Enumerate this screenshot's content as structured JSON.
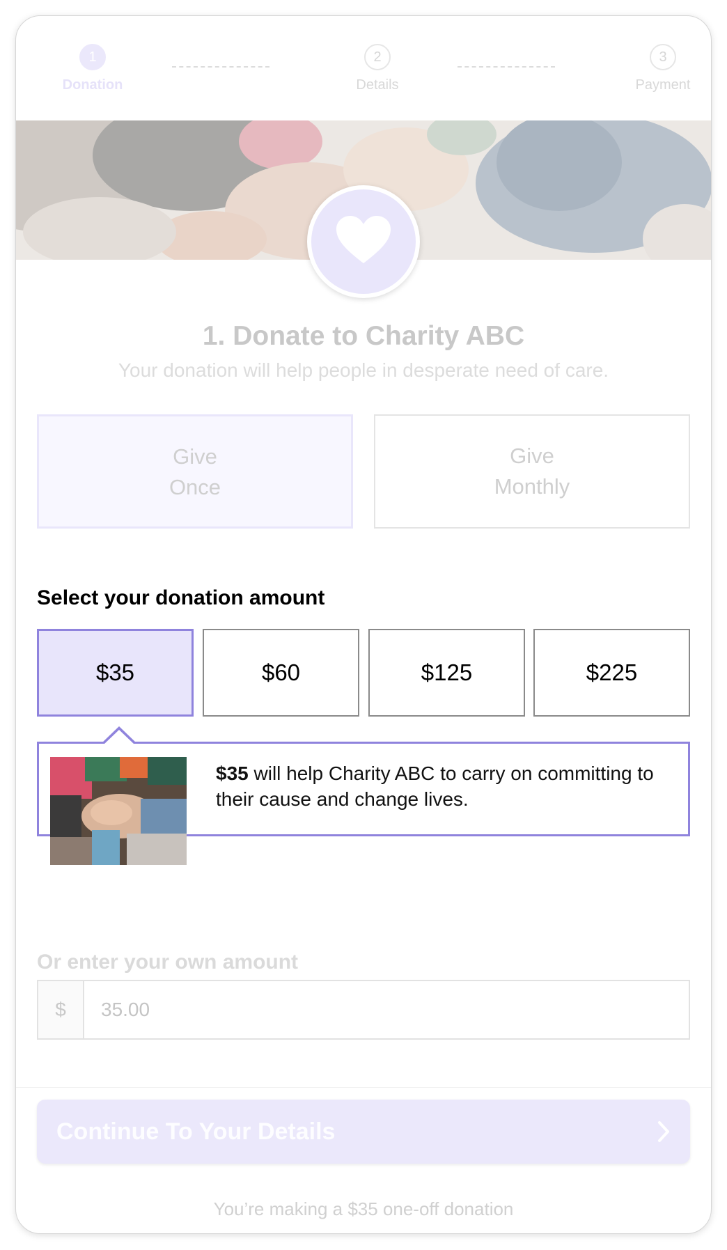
{
  "stepper": {
    "steps": [
      {
        "num": "1",
        "label": "Donation"
      },
      {
        "num": "2",
        "label": "Details"
      },
      {
        "num": "3",
        "label": "Payment"
      }
    ]
  },
  "header": {
    "title": "1. Donate to Charity ABC",
    "subtitle": "Your donation will help people in desperate need of care."
  },
  "frequency": {
    "once_line1": "Give",
    "once_line2": "Once",
    "monthly_line1": "Give",
    "monthly_line2": "Monthly",
    "selected": "once"
  },
  "amount": {
    "heading": "Select your donation amount",
    "options": [
      "$35",
      "$60",
      "$125",
      "$225"
    ],
    "selected": "$35"
  },
  "impact": {
    "amount": "$35",
    "text": " will help Charity ABC to carry on committing to their cause and change lives."
  },
  "custom": {
    "label": "Or enter your own amount",
    "currency": "$",
    "value": "35.00"
  },
  "footer": {
    "continue_label": "Continue To Your Details",
    "summary": "You’re making a $35 one-off donation"
  },
  "colors": {
    "accent": "#8f83dd",
    "accent_light": "#e8e5fb"
  },
  "icons": {
    "badge": "heart-icon",
    "continue": "chevron-right-icon"
  }
}
